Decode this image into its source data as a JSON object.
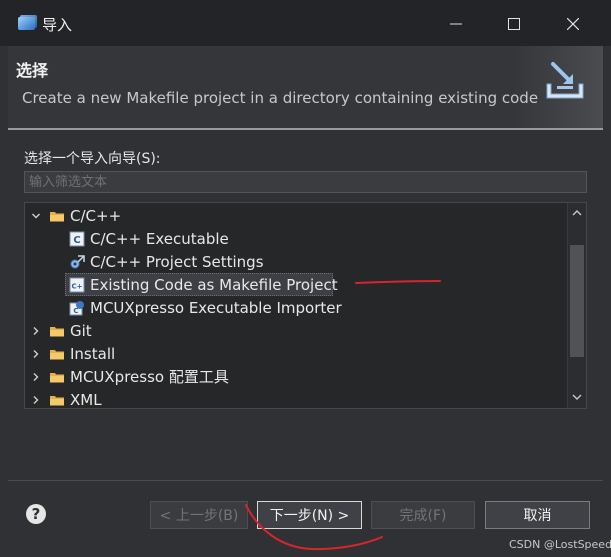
{
  "window": {
    "title": "导入"
  },
  "banner": {
    "title": "选择",
    "description": "Create a new Makefile project in a directory containing existing code"
  },
  "wizard": {
    "prompt": "选择一个导入向导(S):",
    "filter_placeholder": "输入筛选文本",
    "tree": [
      {
        "label": "C/C++",
        "level": 0,
        "expanded": true,
        "icon": "folder-icon"
      },
      {
        "label": "C/C++ Executable",
        "level": 1,
        "icon": "c-file-icon"
      },
      {
        "label": "C/C++ Project Settings",
        "level": 1,
        "icon": "settings-import-icon"
      },
      {
        "label": "Existing Code as Makefile Project",
        "level": 1,
        "icon": "cpp-file-icon",
        "selected": true
      },
      {
        "label": "MCUXpresso Executable Importer",
        "level": 1,
        "icon": "ide-executable-icon"
      },
      {
        "label": "Git",
        "level": 0,
        "expanded": false,
        "icon": "folder-icon"
      },
      {
        "label": "Install",
        "level": 0,
        "expanded": false,
        "icon": "folder-icon"
      },
      {
        "label": "MCUXpresso 配置工具",
        "level": 0,
        "expanded": false,
        "icon": "folder-icon"
      },
      {
        "label": "XML",
        "level": 0,
        "expanded": false,
        "icon": "folder-icon"
      }
    ]
  },
  "buttons": {
    "help": "?",
    "back": "< 上一步(B)",
    "next": "下一步(N) >",
    "finish": "完成(F)",
    "cancel": "取消"
  },
  "watermark": "CSDN @LostSpeed",
  "colors": {
    "titlebar": "#232427",
    "background": "#2f3134",
    "tree_background": "#262729",
    "annotation_red": "#d8242c"
  }
}
